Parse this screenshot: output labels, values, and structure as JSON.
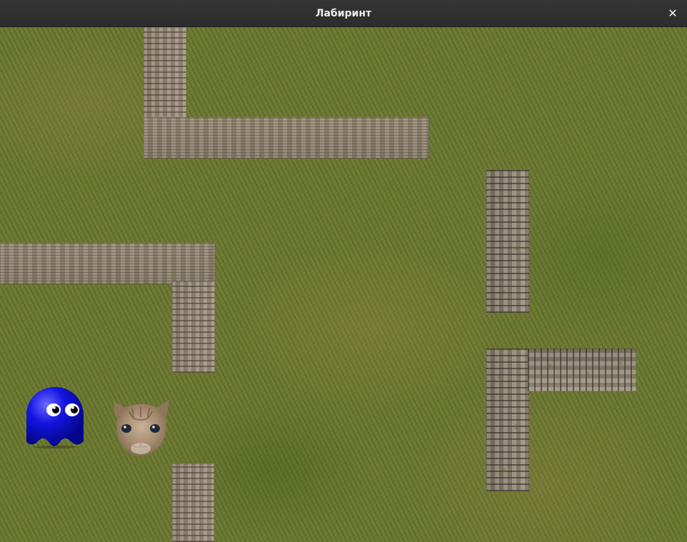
{
  "window": {
    "title": "Лабиринт",
    "close_glyph": "✕"
  },
  "game": {
    "background": "grass-texture",
    "walls": [
      {
        "id": "wall-top-vertical",
        "texture": "stone"
      },
      {
        "id": "wall-top-horizontal",
        "texture": "stone"
      },
      {
        "id": "wall-left-horizontal",
        "texture": "stone"
      },
      {
        "id": "wall-left-vertical",
        "texture": "stone"
      },
      {
        "id": "wall-bottom-vertical",
        "texture": "stone"
      },
      {
        "id": "wall-right-upper-vertical",
        "texture": "mossy-stone"
      },
      {
        "id": "wall-right-lower-vertical",
        "texture": "mossy-stone"
      },
      {
        "id": "wall-right-lower-horizontal",
        "texture": "mossy-stone"
      }
    ],
    "ghost": {
      "icon": "blue-ghost-icon",
      "color": "#1010d0"
    },
    "cat": {
      "icon": "cat-face-icon",
      "color": "#9a7f63"
    }
  }
}
